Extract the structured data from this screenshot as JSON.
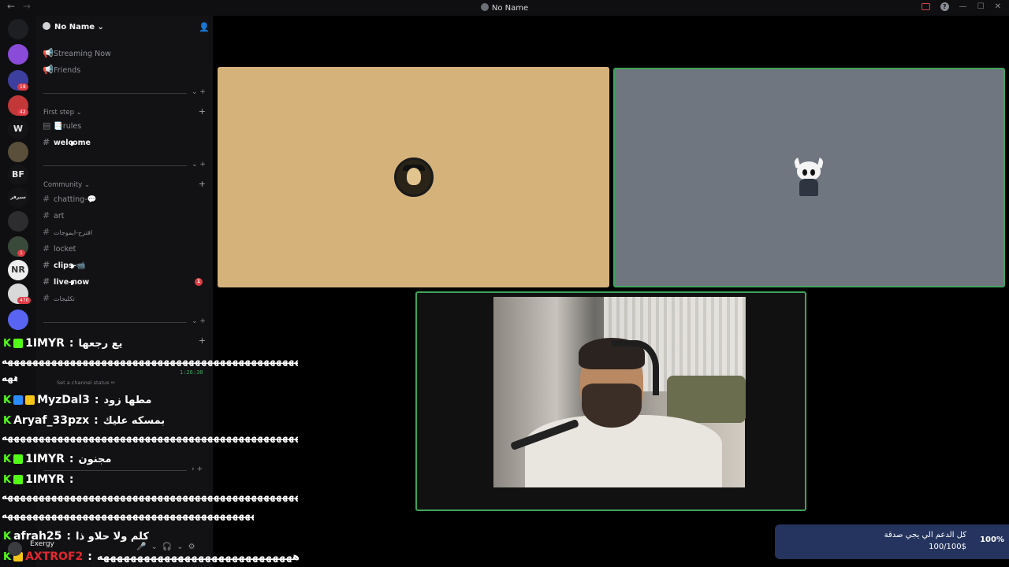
{
  "titlebar": {
    "title": "No Name",
    "back": "←",
    "forward": "→",
    "help": "?",
    "minimize": "—",
    "maximize": "☐",
    "close": "✕"
  },
  "rail": {
    "home_icon": "discord-icon",
    "servers": [
      {
        "color": "#8a4bd8",
        "badge": ""
      },
      {
        "color": "#3c3f9e",
        "badge": "18"
      },
      {
        "color": "#c23838",
        "badge": "42"
      },
      {
        "color": "#141416",
        "badge": "",
        "label": "W"
      },
      {
        "color": "#5a4f3b",
        "badge": ""
      },
      {
        "color": "#141416",
        "badge": "",
        "label": "BF"
      },
      {
        "color": "#141416",
        "badge": "",
        "label": "سيرفر"
      },
      {
        "color": "#2d2d30",
        "badge": ""
      },
      {
        "color": "#3a4a3a",
        "badge": "1"
      },
      {
        "color": "#eeeeee",
        "badge": "",
        "label": "NR"
      },
      {
        "color": "#d9d9d9",
        "badge": "470"
      },
      {
        "color": "#5865f2",
        "badge": ""
      }
    ]
  },
  "server": {
    "name": "No Name",
    "top_items": [
      {
        "label": "Streaming Now",
        "icon": "megaphone-icon"
      },
      {
        "label": "Friends",
        "icon": "megaphone-icon"
      }
    ],
    "categories": [
      {
        "name": "First step",
        "channels": [
          {
            "label": "📑rules",
            "bold": false,
            "icon": "rules-icon"
          },
          {
            "label": "welcome",
            "bold": true,
            "icon": "hash-icon"
          }
        ]
      },
      {
        "name": "Community",
        "channels": [
          {
            "label": "chatting-💬",
            "bold": false
          },
          {
            "label": "art",
            "bold": false
          },
          {
            "label": "اقترح-ايموجات",
            "bold": false
          },
          {
            "label": "locket",
            "bold": false
          },
          {
            "label": "clips-📹",
            "bold": true
          },
          {
            "label": "live-now",
            "bold": true,
            "mention": "1"
          },
          {
            "label": "تكليجات",
            "bold": false
          }
        ]
      }
    ],
    "voice": {
      "timer": "1:26:38",
      "status_placeholder": "Set a channel status ✏"
    },
    "hash": "#",
    "collapse": "⌄",
    "plus": "+"
  },
  "stage": {
    "tile_colors": {
      "a": "#d4b27a",
      "b": "#6f7680"
    }
  },
  "chat": {
    "messages": [
      {
        "user": "1IMYR",
        "color": "#ffffff",
        "text": "يع رجعها",
        "badges": [
          "#53fc18"
        ]
      },
      {
        "user": "MyzDal3",
        "color": "#ffffff",
        "text": "مطها زود",
        "badges": [
          "#2a8cff",
          "#f5c518"
        ]
      },
      {
        "user": "Aryaf_33pzx",
        "color": "#ffffff",
        "text": "بمسكه عليك",
        "badges": []
      },
      {
        "user": "1IMYR",
        "color": "#ffffff",
        "text": "مجنون",
        "badges": [
          "#53fc18"
        ]
      },
      {
        "user": "1IMYR",
        "color": "#ffffff",
        "text": "",
        "badges": [
          "#53fc18"
        ]
      },
      {
        "user": "afrah25",
        "color": "#ffffff",
        "text": "كلم ولا حلاو ذا",
        "badges": []
      },
      {
        "user": "AXTROF2",
        "color": "#e3272f",
        "text": "هههههههههههههههههههههههههههههه",
        "badges": [
          "#f5c518"
        ]
      }
    ],
    "spam_lines": [
      "هههههههههههههههههههههههههههههههههههههههههههههههههههههههههههههههههههههههههههههههه",
      "ههه",
      "هههههههههههههههههههههههههههههههههههههههههههههههههههههههههههههههههههههههههههههههه",
      "هههههههههههههههههههههههههههههههههههههههههههههههههههههههههههههههههههههههههههههههه",
      "ههههههههههههههههههههههههههههههههههههههههههههههههههههههههههههههههههه"
    ],
    "kick_glyph": "K"
  },
  "donation": {
    "title": "كل الدعم الي يجي صدقة",
    "amount": "100/100$",
    "percent": "100%"
  },
  "user_panel": {
    "name": "Exergy",
    "controls": "🎤⌄🎧⌄⚙"
  }
}
